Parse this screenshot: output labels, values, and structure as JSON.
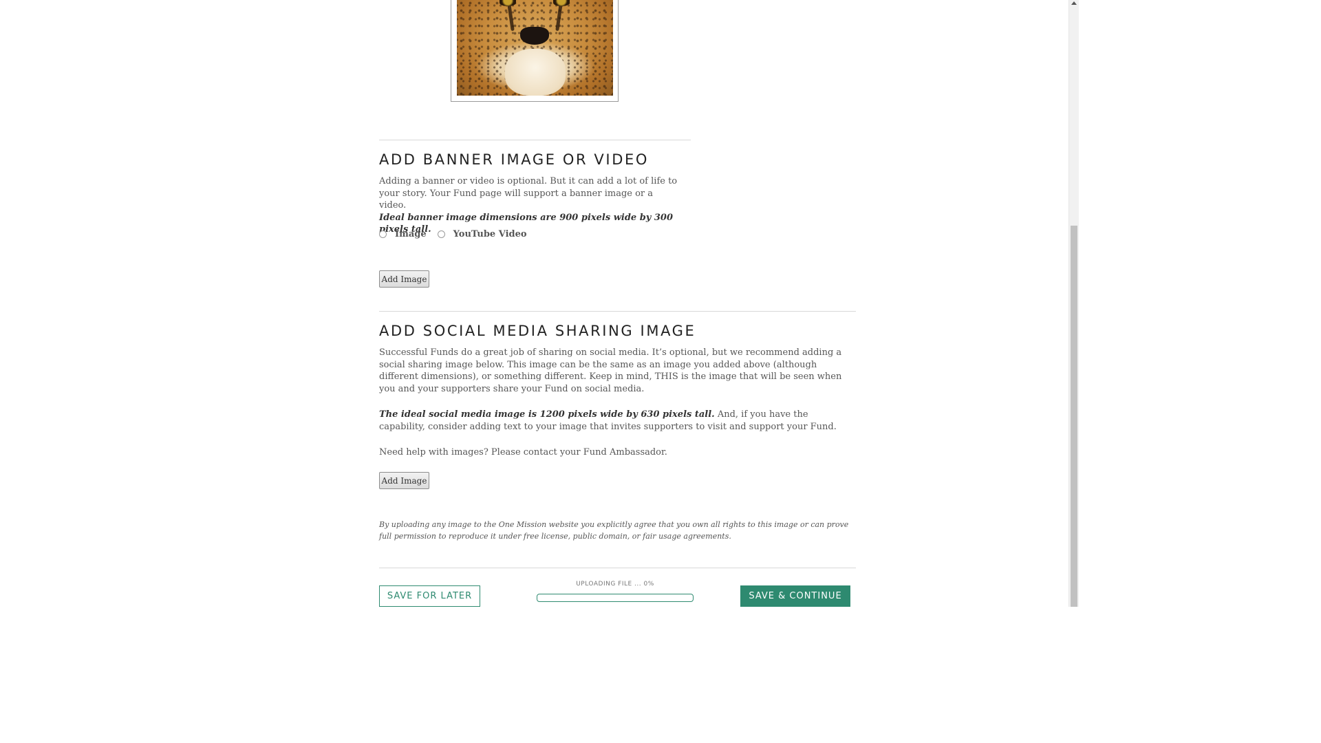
{
  "photo": {
    "alt": "cheetah-photo"
  },
  "banner": {
    "title": "ADD BANNER IMAGE OR VIDEO",
    "description": "Adding a banner or video is optional. But it can add a lot of life to your story. Your Fund page will support a banner image or a video.",
    "dimensions_note": "Ideal banner image dimensions are 900 pixels wide by 300 pixels tall.",
    "options": [
      "Image",
      "YouTube Video"
    ],
    "add_image_label": "Add Image"
  },
  "social": {
    "title": "ADD SOCIAL MEDIA SHARING IMAGE",
    "description": "Successful Funds do a great job of sharing on social media. It’s optional, but we recommend adding a social sharing image below. This image can be the same as an image you added above (although different dimensions), or something different. Keep in mind, THIS is the image that will be seen when you and your supporters share your Fund on social media.",
    "ideal_note": "The ideal social media image is 1200 pixels wide by 630 pixels tall.",
    "ideal_followup": " And, if you have the capability, consider adding text to your image that invites supporters to visit and support your Fund.",
    "help_text": "Need help with images? Please contact your Fund Ambassador.",
    "add_image_label": "Add Image"
  },
  "disclaimer": "By uploading any image to the One Mission website you explicitly agree that you own all rights to this image or can prove full permission to reproduce it under free license, public domain, or fair usage agreements.",
  "footer": {
    "save_later_label": "SAVE FOR LATER",
    "upload_status": "UPLOADING FILE ... 0%",
    "upload_progress": 0,
    "save_continue_label": "SAVE & CONTINUE"
  },
  "colors": {
    "accent": "#2e8a70",
    "text": "#555555",
    "heading": "#222222"
  }
}
